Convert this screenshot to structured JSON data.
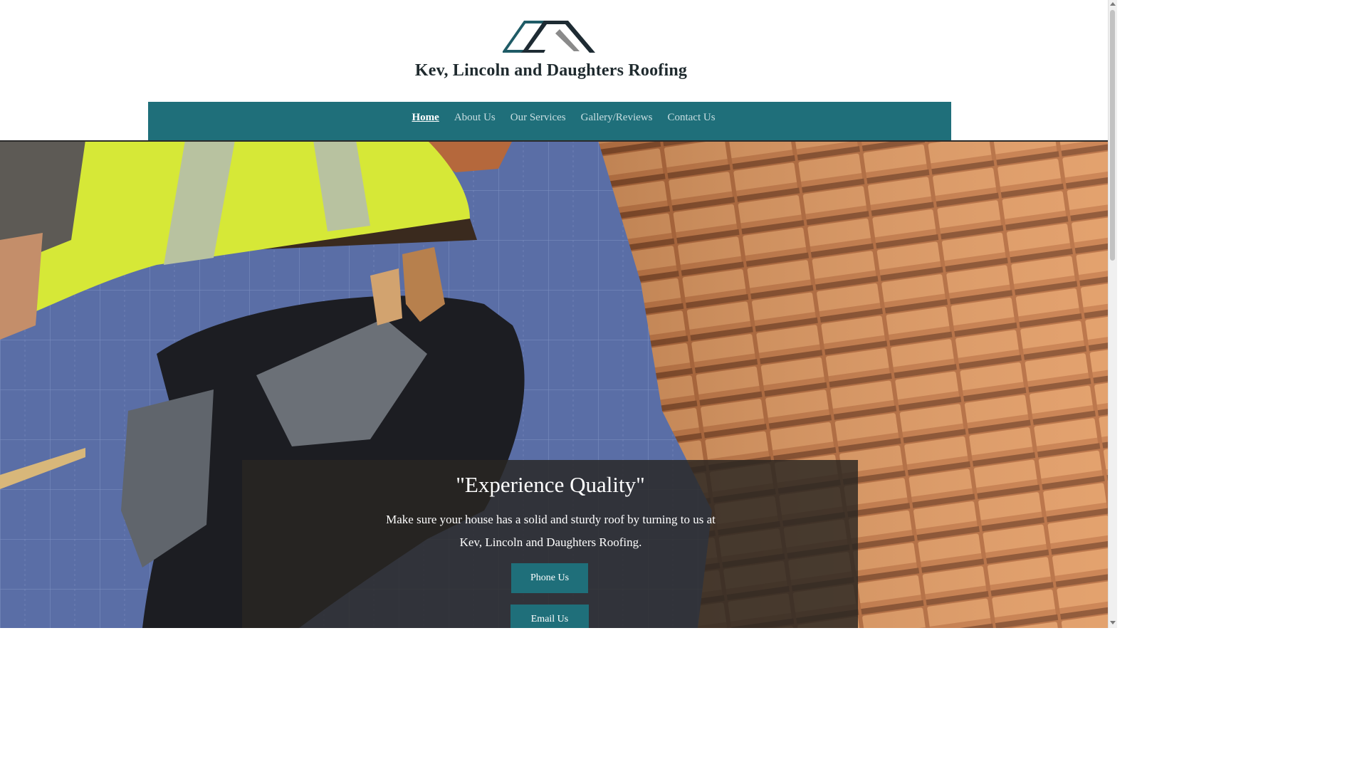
{
  "header": {
    "site_title": "Kev, Lincoln and Daughters Roofing",
    "logo_icon": "roof-logo-icon"
  },
  "nav": {
    "items": [
      {
        "label": "Home",
        "active": true
      },
      {
        "label": "About Us",
        "active": false
      },
      {
        "label": "Our Services",
        "active": false
      },
      {
        "label": "Gallery/Reviews",
        "active": false
      },
      {
        "label": "Contact Us",
        "active": false
      }
    ]
  },
  "hero": {
    "image_subject": "roofer-installing-clay-tiles",
    "heading": "\"Experience Quality\"",
    "text": "Make sure your house has a solid and sturdy roof by turning to us at Kev, Lincoln and Daughters Roofing.",
    "phone_button": "Phone Us",
    "email_button": "Email Us"
  },
  "colors": {
    "brand_teal": "#1f6f7a",
    "logo_dark": "#1e2b33",
    "logo_teal": "#1f5b66",
    "logo_gray": "#8a8a8a",
    "panel_overlay": "#282622",
    "title_text": "#1f2a2e"
  }
}
